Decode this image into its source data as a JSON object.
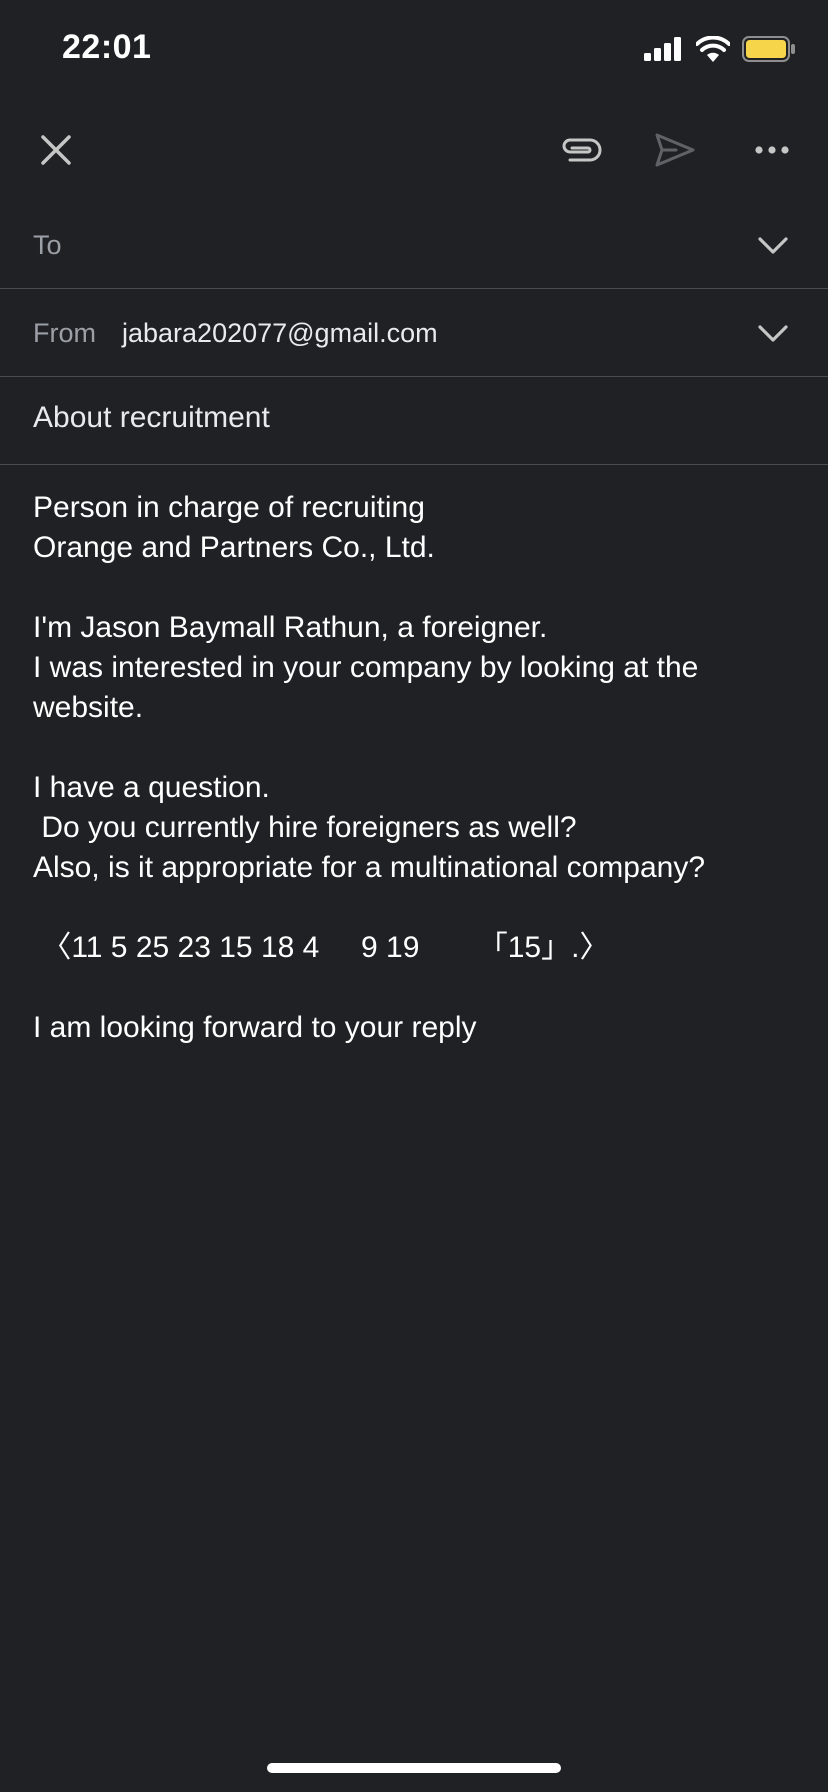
{
  "status_bar": {
    "time": "22:01"
  },
  "toolbar": {
    "close_icon": "close-icon",
    "attach_icon": "paperclip-icon",
    "send_icon": "send-icon",
    "more_icon": "more-horizontal-icon"
  },
  "compose": {
    "to_label": "To",
    "from_label": "From",
    "from_value": "jabara202077@gmail.com",
    "subject": "About recruitment",
    "body_lines": [
      "Person in charge of recruiting",
      "Orange and Partners Co., Ltd.",
      "",
      "I'm Jason Baymall Rathun, a foreigner.",
      "I was interested in your company by looking at the",
      "website.",
      "",
      "I have a question.",
      " Do you currently hire foreigners as well?",
      "Also, is it appropriate for a multinational company?",
      "",
      " 〈11 5 25 23 15 18 4     9 19       「15」.〉",
      "",
      "I am looking forward to your reply"
    ]
  },
  "colors": {
    "background": "#202125",
    "divider": "#4a4c50",
    "label": "#9aa0a6",
    "text": "#ffffff",
    "battery": "#f6d54a"
  }
}
